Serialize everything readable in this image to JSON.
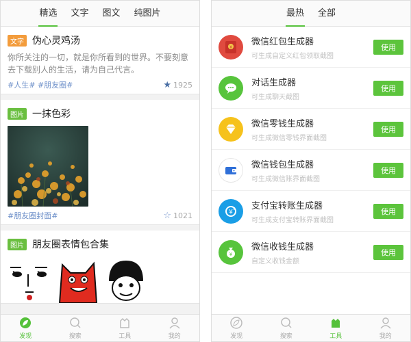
{
  "left": {
    "tabs": [
      "精选",
      "文字",
      "图文",
      "纯图片"
    ],
    "cards": [
      {
        "badge": "文字",
        "title": "伪心灵鸡汤",
        "body": "你所关注的一切，就是你所看到的世界。不要刻意去下载别人的生活，请为自己代言。",
        "tags": "#人生# #朋友圈#",
        "likes": "1925"
      },
      {
        "badge": "图片",
        "title": "一抹色彩",
        "tags": "#朋友圈封面#",
        "likes": "1021"
      },
      {
        "badge": "图片",
        "title": "朋友圈表情包合集"
      }
    ],
    "tabbar": [
      {
        "label": "发现",
        "icon": "leaf-icon"
      },
      {
        "label": "搜索",
        "icon": "search-icon"
      },
      {
        "label": "工具",
        "icon": "tools-icon"
      },
      {
        "label": "我的",
        "icon": "user-icon"
      }
    ]
  },
  "right": {
    "tabs": [
      "最热",
      "全部"
    ],
    "tools": [
      {
        "name": "微信红包生成器",
        "desc": "可生成自定义红包领取截图",
        "button": "使用",
        "icon": "red-envelope-icon",
        "color": "#e04a3f"
      },
      {
        "name": "对话生成器",
        "desc": "可生成聊天截图",
        "button": "使用",
        "icon": "chat-bubble-icon",
        "color": "#57c43c"
      },
      {
        "name": "微信零钱生成器",
        "desc": "可生成微信零钱界面截图",
        "button": "使用",
        "icon": "diamond-icon",
        "color": "#f6c21c"
      },
      {
        "name": "微信钱包生成器",
        "desc": "可生成微信账界面截图",
        "button": "使用",
        "icon": "wallet-icon",
        "color": "#ffffff"
      },
      {
        "name": "支付宝转账生成器",
        "desc": "可生成支付宝转账界面截图",
        "button": "使用",
        "icon": "alipay-transfer-icon",
        "color": "#1a9ee6"
      },
      {
        "name": "微信收钱生成器",
        "desc": "自定义收钱金额",
        "button": "使用",
        "icon": "money-bag-icon",
        "color": "#57c43c"
      }
    ],
    "tabbar": [
      {
        "label": "发现",
        "icon": "leaf-icon"
      },
      {
        "label": "搜索",
        "icon": "search-icon"
      },
      {
        "label": "工具",
        "icon": "tools-icon"
      },
      {
        "label": "我的",
        "icon": "user-icon"
      }
    ]
  },
  "colors": {
    "accent": "#55c13a",
    "tag_blue": "#6b8ec8",
    "badge_orange": "#f39c3c"
  }
}
